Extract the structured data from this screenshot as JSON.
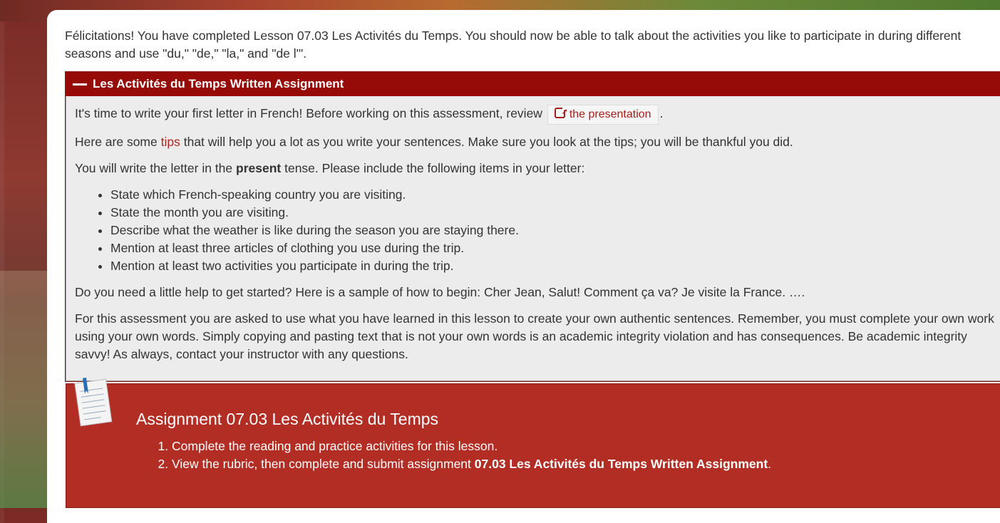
{
  "intro": "Félicitations! You have completed Lesson 07.03 Les Activités du Temps. You should now be able to talk about the activities you like to participate in during different seasons and use \"du,\" \"de,\" \"la,\" and \"de l'\".",
  "accordion": {
    "title": "Les Activités du Temps Written Assignment",
    "p1_before": "It's time to write your first letter in French! Before working on this assessment, review",
    "p1_link": "the presentation",
    "p1_after": ".",
    "p2_before": "Here are some",
    "p2_link": "tips",
    "p2_after": "that will help you a lot as you write your sentences. Make sure you look at the tips; you will be thankful you did.",
    "p3_before": "You will write the letter in the",
    "p3_bold": "present",
    "p3_after": "tense. Please include the following items in your letter:",
    "items": [
      "State which French-speaking country you are visiting.",
      "State the month you are visiting.",
      "Describe what the weather is like during the season you are staying there.",
      "Mention at least three articles of clothing you use during the trip.",
      "Mention at least two activities you participate in during the trip."
    ],
    "p4": "Do you need a little help to get started? Here is a sample of how to begin: Cher Jean, Salut! Comment ça va? Je visite la France. ….",
    "p5": "For this assessment you are asked to use what you have learned in this lesson to create your own authentic sentences. Remember, you must complete your own work using your own words. Simply copying and pasting text that is not your own words is an academic integrity violation and has consequences. Be academic integrity savvy! As always, contact your instructor with any questions."
  },
  "assignment": {
    "title": "Assignment 07.03 Les Activités du Temps",
    "step1": "Complete the reading and practice activities for this lesson.",
    "step2_before": "View the rubric, then complete and submit assignment",
    "step2_bold": "07.03 Les Activités du Temps Written Assignment",
    "step2_after": "."
  }
}
